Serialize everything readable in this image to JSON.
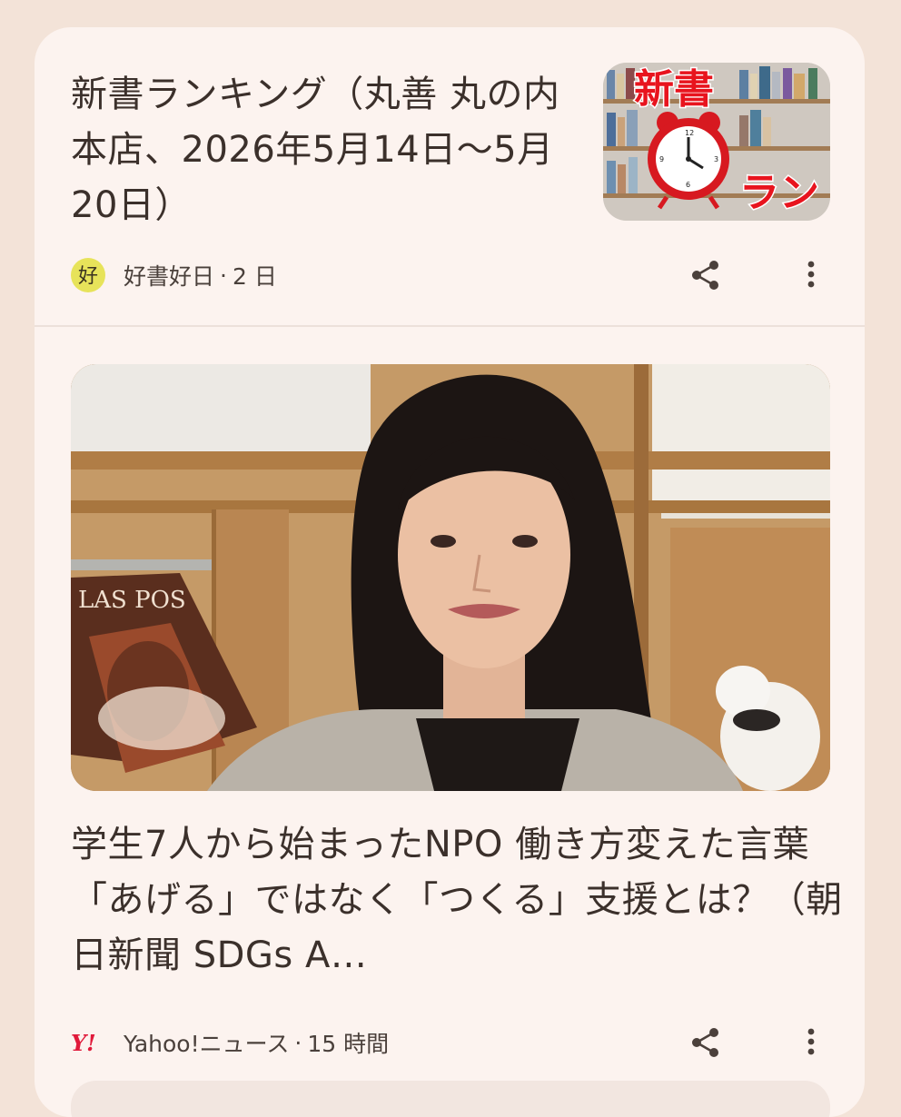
{
  "feed": [
    {
      "title": "新書ランキング（丸善 丸の内本店、2026年5月14日〜5月20日）",
      "source": "好書好日",
      "age": "2 日",
      "source_icon": "kosho-kojitsu-logo-icon",
      "source_icon_text": "好",
      "thumb_text": {
        "top": "新書",
        "bottom": "ラン"
      },
      "share_icon": "share-icon",
      "more_icon": "more-vertical-icon"
    },
    {
      "title": "学生7人から始まったNPO 働き方変えた言葉 「あげる」ではなく「つくる」支援とは？（朝日新聞 SDGs A…",
      "source": "Yahoo!ニュース",
      "age": "15 時間",
      "source_icon": "yahoo-logo-icon",
      "source_icon_text": "Y!",
      "photo_text": "LAS POS",
      "share_icon": "share-icon",
      "more_icon": "more-vertical-icon"
    }
  ],
  "separator": "·",
  "colors": {
    "page_bg": "#f3e3d8",
    "card_bg": "#fcf3ef",
    "text": "#3b302b",
    "yahoo_red": "#e0193a"
  }
}
